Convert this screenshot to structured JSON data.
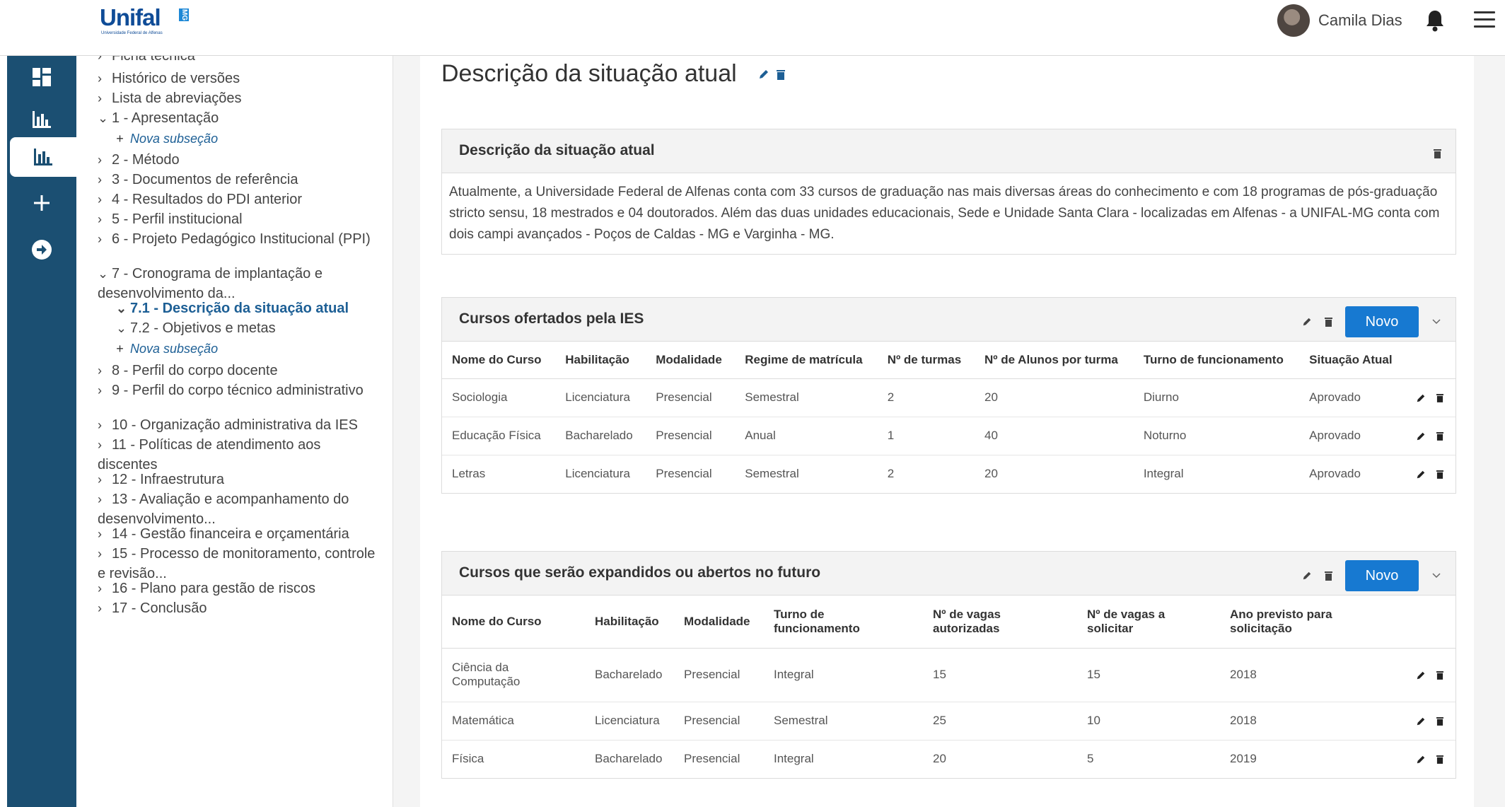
{
  "header": {
    "logo_text": "Unifal",
    "logo_badge": "MG",
    "logo_sub": "Universidade Federal de Alfenas",
    "user_name": "Camila Dias"
  },
  "rail": {
    "items": [
      {
        "icon": "dashboard-icon"
      },
      {
        "icon": "bar-chart-icon"
      },
      {
        "icon": "bar-chart-icon"
      },
      {
        "icon": "plus-icon"
      },
      {
        "icon": "arrow-circle-right-icon"
      }
    ]
  },
  "tree": {
    "items": [
      {
        "label": "Ficha técnica"
      },
      {
        "label": "Histórico de versões"
      },
      {
        "label": "Lista de abreviações"
      },
      {
        "label": "1 - Apresentação"
      },
      {
        "label": "Nova subseção"
      },
      {
        "label": "2 - Método"
      },
      {
        "label": "3 - Documentos de referência"
      },
      {
        "label": "4 - Resultados do PDI anterior"
      },
      {
        "label": "5 - Perfil institucional"
      },
      {
        "label": "6 - Projeto Pedagógico Institucional (PPI)"
      },
      {
        "label": "7 - Cronograma de implantação e desenvolvimento da..."
      },
      {
        "label": "7.1 - Descrição da situação atual"
      },
      {
        "label": "7.2 - Objetivos e metas"
      },
      {
        "label": "Nova subseção"
      },
      {
        "label": "8 - Perfil do corpo docente"
      },
      {
        "label": "9 - Perfil do corpo técnico administrativo"
      },
      {
        "label": "10 - Organização administrativa da IES"
      },
      {
        "label": "11 - Políticas de atendimento aos discentes"
      },
      {
        "label": "12 - Infraestrutura"
      },
      {
        "label": "13 - Avaliação e acompanhamento do desenvolvimento..."
      },
      {
        "label": "14 - Gestão financeira e orçamentária"
      },
      {
        "label": "15 - Processo de monitoramento, controle e revisão..."
      },
      {
        "label": "16 - Plano para gestão de riscos"
      },
      {
        "label": "17 - Conclusão"
      }
    ]
  },
  "main": {
    "page_title": "Descrição da situação atual",
    "card1": {
      "title": "Descrição da situação atual",
      "text": "Atualmente, a Universidade Federal de Alfenas conta com 33 cursos de graduação nas mais diversas áreas do conhecimento e com 18 programas de pós-graduação stricto sensu, 18 mestrados e 04 doutorados. Além das duas unidades educacionais, Sede e Unidade Santa Clara - localizadas em Alfenas - a UNIFAL-MG conta com dois campi avançados - Poços de Caldas - MG e Varginha - MG."
    },
    "card2": {
      "title": "Cursos ofertados pela IES",
      "button": "Novo",
      "columns": [
        "Nome do Curso",
        "Habilitação",
        "Modalidade",
        "Regime de matrícula",
        "Nº de turmas",
        "Nº de Alunos por turma",
        "Turno de funcionamento",
        "Situação Atual"
      ],
      "rows": [
        [
          "Sociologia",
          "Licenciatura",
          "Presencial",
          "Semestral",
          "2",
          "20",
          "Diurno",
          "Aprovado"
        ],
        [
          "Educação Física",
          "Bacharelado",
          "Presencial",
          "Anual",
          "1",
          "40",
          "Noturno",
          "Aprovado"
        ],
        [
          "Letras",
          "Licenciatura",
          "Presencial",
          "Semestral",
          "2",
          "20",
          "Integral",
          "Aprovado"
        ]
      ]
    },
    "card3": {
      "title": "Cursos que serão expandidos ou abertos no futuro",
      "button": "Novo",
      "columns": [
        "Nome do Curso",
        "Habilitação",
        "Modalidade",
        "Turno de funcionamento",
        "Nº de vagas autorizadas",
        "Nº de vagas a solicitar",
        "Ano previsto para solicitação"
      ],
      "rows": [
        [
          "Ciência da Computação",
          "Bacharelado",
          "Presencial",
          "Integral",
          "15",
          "15",
          "2018"
        ],
        [
          "Matemática",
          "Licenciatura",
          "Presencial",
          "Semestral",
          "25",
          "10",
          "2018"
        ],
        [
          "Física",
          "Bacharelado",
          "Presencial",
          "Integral",
          "20",
          "5",
          "2019"
        ]
      ]
    }
  }
}
